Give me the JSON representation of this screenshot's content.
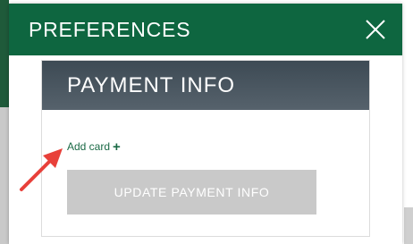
{
  "modal": {
    "title": "PREFERENCES",
    "close_icon": "close-icon"
  },
  "payment_card": {
    "title": "PAYMENT INFO",
    "add_card_label": "Add card",
    "add_card_icon": "+",
    "update_button_label": "UPDATE PAYMENT INFO"
  },
  "colors": {
    "header_green": "#0e6640",
    "card_header_gray": "#4a5660",
    "link_green": "#1b6a46",
    "button_disabled_gray": "#c9c9c9",
    "annotation_red": "#e8403a"
  }
}
